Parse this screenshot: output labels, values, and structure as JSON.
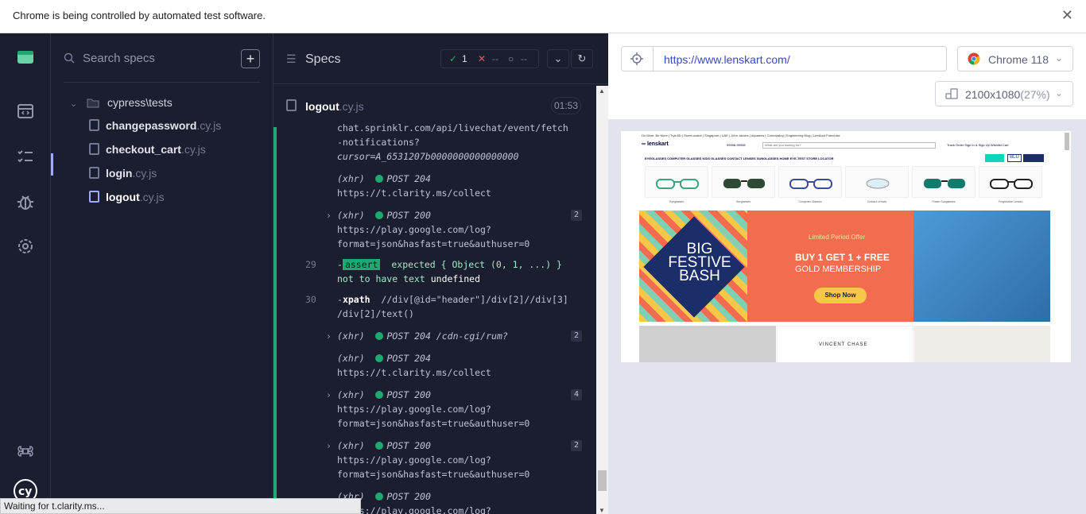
{
  "infobar": {
    "message": "Chrome is being controlled by automated test software.",
    "close": "✕"
  },
  "specs_panel": {
    "search_placeholder": "Search specs",
    "add_label": "+",
    "folder": "cypress\\tests",
    "files": [
      {
        "name": "changepassword",
        "ext": ".cy.js"
      },
      {
        "name": "checkout_cart",
        "ext": ".cy.js"
      },
      {
        "name": "login",
        "ext": ".cy.js"
      },
      {
        "name": "logout",
        "ext": ".cy.js"
      }
    ]
  },
  "reporter": {
    "title": "Specs",
    "passed": "1",
    "failed": "--",
    "pending": "--",
    "spec_name": "logout",
    "spec_ext": ".cy.js",
    "duration": "01:53",
    "commands": [
      {
        "lines": [
          "chat.sprinklr.com/api/livechat/event/fetch",
          "-notifications?",
          "cursor=A_6531207b0000000000000000"
        ]
      },
      {
        "xhr": "(xhr)",
        "method": "POST 204",
        "url": "https://t.clarity.ms/collect"
      },
      {
        "xhr": "(xhr)",
        "method": "POST 200",
        "url": "https://play.google.com/log?",
        "url2": "format=json&hasfast=true&authuser=0",
        "count": "2"
      },
      {
        "num": "29",
        "type": "assert",
        "text": "expected { Object (0, 1, ...) }",
        "text2": "not to have text",
        "text3": "undefined"
      },
      {
        "num": "30",
        "type": "xpath",
        "text": "//div[@id=\"header\"]/div[2]//div[3]",
        "text2": "/div[2]/text()"
      },
      {
        "xhr": "(xhr)",
        "method": "POST 204 /cdn-cgi/rum?",
        "count": "2"
      },
      {
        "xhr": "(xhr)",
        "method": "POST 204",
        "url": "https://t.clarity.ms/collect"
      },
      {
        "xhr": "(xhr)",
        "method": "POST 200",
        "url": "https://play.google.com/log?",
        "url2": "format=json&hasfast=true&authuser=0",
        "count": "4"
      },
      {
        "xhr": "(xhr)",
        "method": "POST 200",
        "url": "https://play.google.com/log?",
        "url2": "format=json&hasfast=true&authuser=0",
        "count": "2"
      },
      {
        "xhr": "(xhr)",
        "method": "POST 200",
        "url": "https://play.google.com/log?"
      }
    ]
  },
  "status_bar": "Waiting for t.clarity.ms...",
  "aut": {
    "url": "https://www.lenskart.com/",
    "browser": "Chrome 118",
    "viewport": "2100x1080",
    "zoom": "(27%)"
  },
  "site": {
    "topline": "Do More, Be More | Tryin3D | StoreLocator | Singapore | UAE | John Jacobs | Aqualens | Cobrowsing | Engineering Blog | Lenskart Franchise",
    "logo": "lenskart",
    "phone": "99998-99998",
    "search": "What are you looking for?",
    "header_links": "Track Order   Sign In & Sign Up   Wishlist   Cart",
    "categories": "EYEGLASSES   COMPUTER GLASSES   KIDS GLASSES   CONTACT LENSES   SUNGLASSES   HOME EYE-TEST   STORE LOCATOR",
    "tiles": [
      "Eyeglasses",
      "Sunglasses",
      "Computer Glasses",
      "Contact Lenses",
      "Power Sunglasses",
      "Progressive Lenses"
    ],
    "banner": {
      "big": "BIG FESTIVE BASH",
      "limited": "Limited Period Offer",
      "offer": "BUY 1 GET 1 + FREE",
      "gold": "GOLD MEMBERSHIP",
      "shop": "Shop Now"
    },
    "brand": "VINCENT CHASE"
  }
}
